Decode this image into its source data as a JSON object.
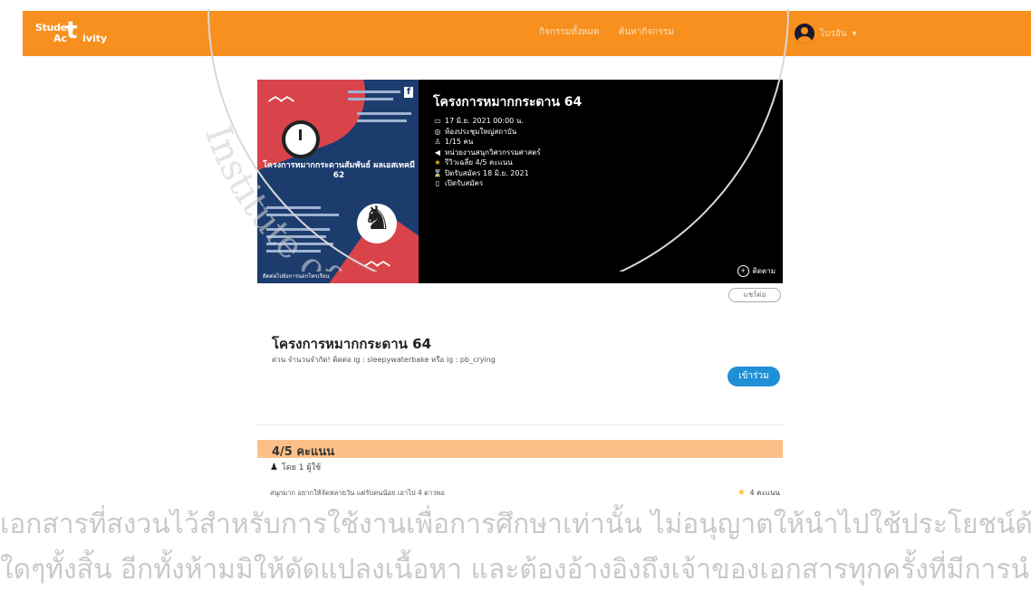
{
  "header": {
    "logo": {
      "part1": "Studen",
      "big": "t",
      "part2": "Ac",
      "part3": "ivity"
    },
    "nav": [
      "กิจกรรมทั้งหมด",
      "ค้นหากิจกรรม"
    ],
    "user_name": "ไบรอัน"
  },
  "banner": {
    "poster": {
      "title": "โครงการหมากกระดานสัมพันธ์ ผลเอสเทคมี 62",
      "footer": "ติดต่อไปยังการนอกโทรเรียน"
    },
    "title": "โครงการหมากกระดาน 64",
    "details": [
      {
        "icon": "calendar-icon",
        "text": "17 มิ.ย. 2021 00:00 น."
      },
      {
        "icon": "location-icon",
        "text": "ห้องประชุมใหญ่สถาบัน"
      },
      {
        "icon": "people-icon",
        "text": "1/15 คน"
      },
      {
        "icon": "megaphone-icon",
        "text": "หน่วยงานสนุกวิศวกรรมศาสตร์"
      },
      {
        "icon": "star-icon",
        "text": "รีวิวเฉลี่ย 4/5 คะแนน"
      },
      {
        "icon": "hourglass-icon",
        "text": "ปิดรับสมัคร 18 มิ.ย. 2021"
      },
      {
        "icon": "door-icon",
        "text": "เปิดรับสมัคร"
      }
    ],
    "follow_label": "ติดตาม"
  },
  "share_label": "แชร์ต่อ",
  "activity": {
    "title": "โครงการหมากกระดาน 64",
    "description": "ด่วน จำนวนจำกัด! ติดต่อ ig : sleepywaterbake หรือ ig : pb_crying",
    "join_label": "เข้าร่วม"
  },
  "rating": {
    "score_label": "4/5 คะแนน",
    "by_label": "โดย 1 ผู้ใช้",
    "review_text": "สนุกมาก อยากให้จัดหลายวัน แต่รับคนน้อย เอาไป 4 ดาวพอ",
    "review_score": "4 คะแนน"
  },
  "watermark": {
    "line1": "เอกสารที่สงวนไว้สำหรับการใช้งานเพื่อการศึกษาเท่านั้น ไม่อนุญาตให้นำไปใช้ประโยชน์ด้านก",
    "line2": "ใดๆทั้งสิ้น อีกทั้งห้ามมิให้ดัดแปลงเนื้อหา และต้องอ้างอิงถึงเจ้าของเอกสารทุกครั้งที่มีการนำไป",
    "seal_text": "Institute of Technology"
  },
  "colors": {
    "accent": "#f7901e",
    "button": "#1f8fd6",
    "score_bar": "#fcc088"
  }
}
